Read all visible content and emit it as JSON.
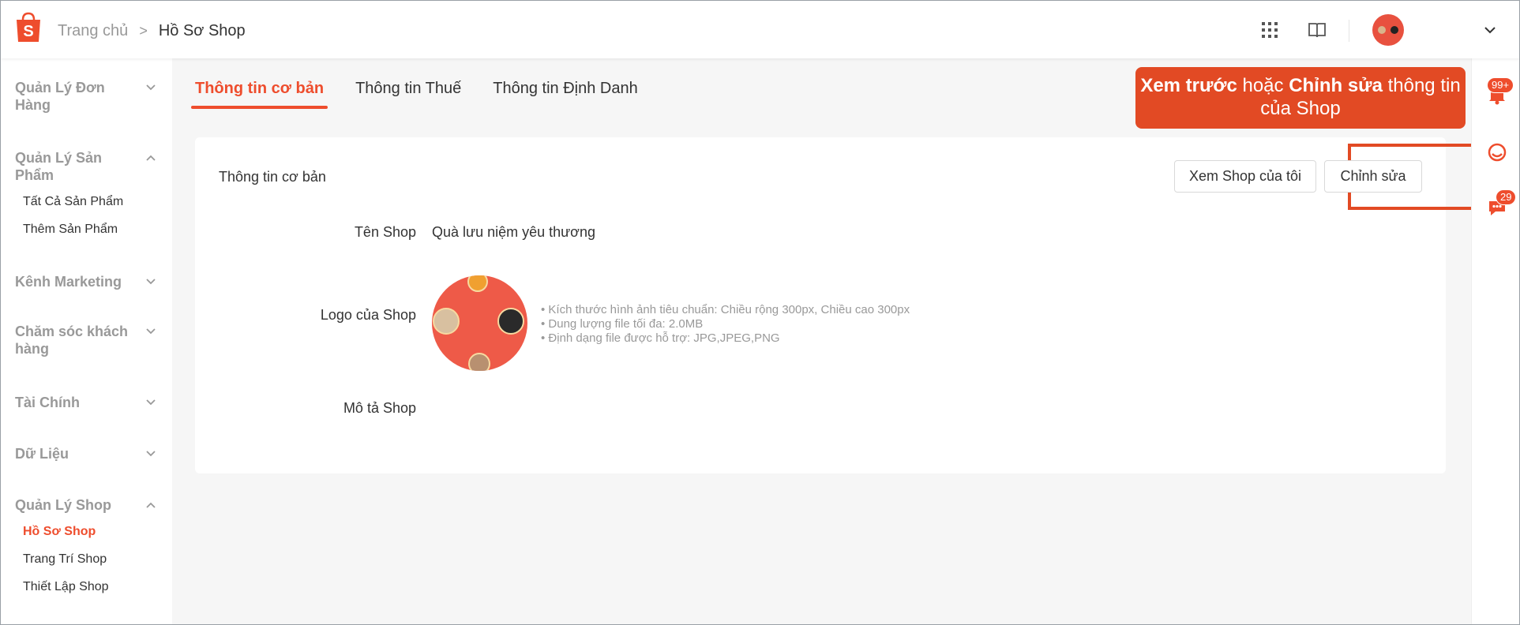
{
  "header": {
    "breadcrumb_home": "Trang chủ",
    "breadcrumb_separator": ">",
    "breadcrumb_current": "Hồ Sơ Shop",
    "icons": [
      "shopee-logo-icon",
      "apps-grid-icon",
      "book-icon",
      "avatar",
      "chevron-down-icon"
    ]
  },
  "sidebar": {
    "groups": [
      {
        "label": "Quản Lý Đơn Hàng",
        "expanded": false
      },
      {
        "label": "Quản Lý Sản Phẩm",
        "expanded": true,
        "items": [
          "Tất Cả Sản Phẩm",
          "Thêm Sản Phẩm"
        ]
      },
      {
        "label": "Kênh Marketing",
        "expanded": false
      },
      {
        "label": "Chăm sóc khách hàng",
        "expanded": false
      },
      {
        "label": "Tài Chính",
        "expanded": false
      },
      {
        "label": "Dữ Liệu",
        "expanded": false
      },
      {
        "label": "Quản Lý Shop",
        "expanded": true,
        "items": [
          "Hồ Sơ Shop",
          "Trang Trí Shop",
          "Thiết Lập Shop"
        ],
        "active_item": "Hồ Sơ Shop"
      }
    ]
  },
  "tabs": [
    {
      "label": "Thông tin cơ bản",
      "active": true
    },
    {
      "label": "Thông tin Thuế",
      "active": false
    },
    {
      "label": "Thông tin Định Danh",
      "active": false
    }
  ],
  "callout": {
    "bold1": "Xem trước",
    "mid": " hoặc ",
    "bold2": "Chỉnh sửa",
    "tail": " thông tin của Shop"
  },
  "card": {
    "title": "Thông tin cơ bản",
    "view_shop_button": "Xem Shop của tôi",
    "edit_button": "Chỉnh sửa",
    "shop_name_label": "Tên Shop",
    "shop_name_value": "Quà lưu niệm yêu thương",
    "logo_label": "Logo của Shop",
    "logo_hints": [
      "• Kích thước hình ảnh tiêu chuẩn: Chiều rộng 300px, Chiều cao 300px",
      "• Dung lượng file tối đa: 2.0MB",
      "• Định dạng file được hỗ trợ: JPG,JPEG,PNG"
    ],
    "description_label": "Mô tả Shop"
  },
  "rail": {
    "notification_badge": "99+",
    "chat_badge": "29"
  },
  "colors": {
    "brand": "#ee4d2d",
    "callout": "#e24a24",
    "background": "#f6f6f6"
  }
}
